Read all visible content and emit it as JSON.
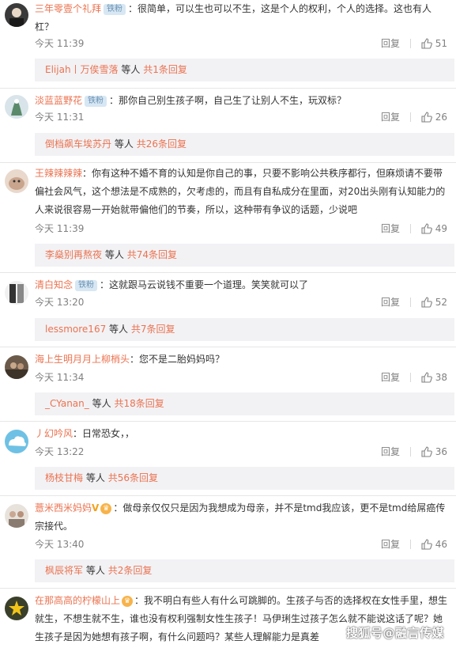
{
  "labels": {
    "reply": "回复",
    "rme": "等人",
    "sep_bar": "|"
  },
  "comments": [
    {
      "user": "三年零壹个礼拜",
      "badge": "铁粉",
      "text": "：很简单，可以生也可以不生，这是个人的权利，个人的选择。这也有人杠？",
      "time": "今天 11:39",
      "likes": "51",
      "replies": {
        "users": "Elijah丨万俟雪落",
        "more": "共1条回复"
      }
    },
    {
      "user": "淡蓝蓝野花",
      "badge": "铁粉",
      "text": "：那你自己别生孩子啊，自己生了让别人不生，玩双标？",
      "time": "今天 11:31",
      "likes": "26",
      "replies": {
        "users": "倒档飙车埃苏丹",
        "more": "共26条回复"
      }
    },
    {
      "user": "王辣辣辣辣",
      "badge": "",
      "text": "：你有这种不婚不育的认知是你自己的事，只要不影响公共秩序都行，但麻烦请不要带偏社会风气，这个想法是不成熟的，欠考虑的，而且有自私成分在里面，对20出头刚有认知能力的人来说很容易一开始就带偏他们的节奏，所以，这种带有争议的话题，少说吧",
      "time": "今天 11:39",
      "likes": "49",
      "replies": {
        "users": "李燊别再熬夜",
        "more": "共74条回复"
      }
    },
    {
      "user": "清白知念",
      "badge": "铁粉",
      "text": "：这就跟马云说钱不重要一个道理。笑笑就可以了",
      "time": "今天 13:20",
      "likes": "52",
      "replies": {
        "users": "lessmore167",
        "more": "共7条回复"
      }
    },
    {
      "user": "海上生明月月上柳梢头",
      "badge": "",
      "text": "：您不是二胎妈妈吗？",
      "time": "今天 11:34",
      "likes": "38",
      "replies": {
        "users": "_CYanan_",
        "more": "共18条回复"
      }
    },
    {
      "user": "丿幻吟风",
      "badge": "",
      "text": "：日常恐女，，",
      "time": "今天 13:22",
      "likes": "36",
      "replies": {
        "users": "杨枝甘梅",
        "more": "共56条回复"
      }
    },
    {
      "user": "薏米西米妈妈",
      "badge": "",
      "vip": "V",
      "text": "：做母亲仅仅只是因为我想成为母亲，并不是tmd我应该，更不是tmd给屌癌传宗接代。",
      "time": "今天 13:40",
      "likes": "46",
      "replies": {
        "users": "枫辰将军",
        "more": "共2条回复"
      }
    },
    {
      "user": "在那高高的柠檬山上",
      "badge": "",
      "text": "：我不明白有些人有什么可跳脚的。生孩子与否的选择权在女性手里，想生就生，不想生就不生，谁也没有权利强制女性生孩子！马伊琍生过孩子怎么就不能说这话了呢？她生孩子是因为她想有孩子啊，有什么问题吗？某些人理解能力是真差"
    }
  ],
  "watermark": "搜狐号@融言传媒",
  "colors": {
    "username": "#eb7350",
    "meta": "#808080",
    "reply_bg": "#f2f2f5",
    "badge_bg": "#d7e7f3"
  }
}
